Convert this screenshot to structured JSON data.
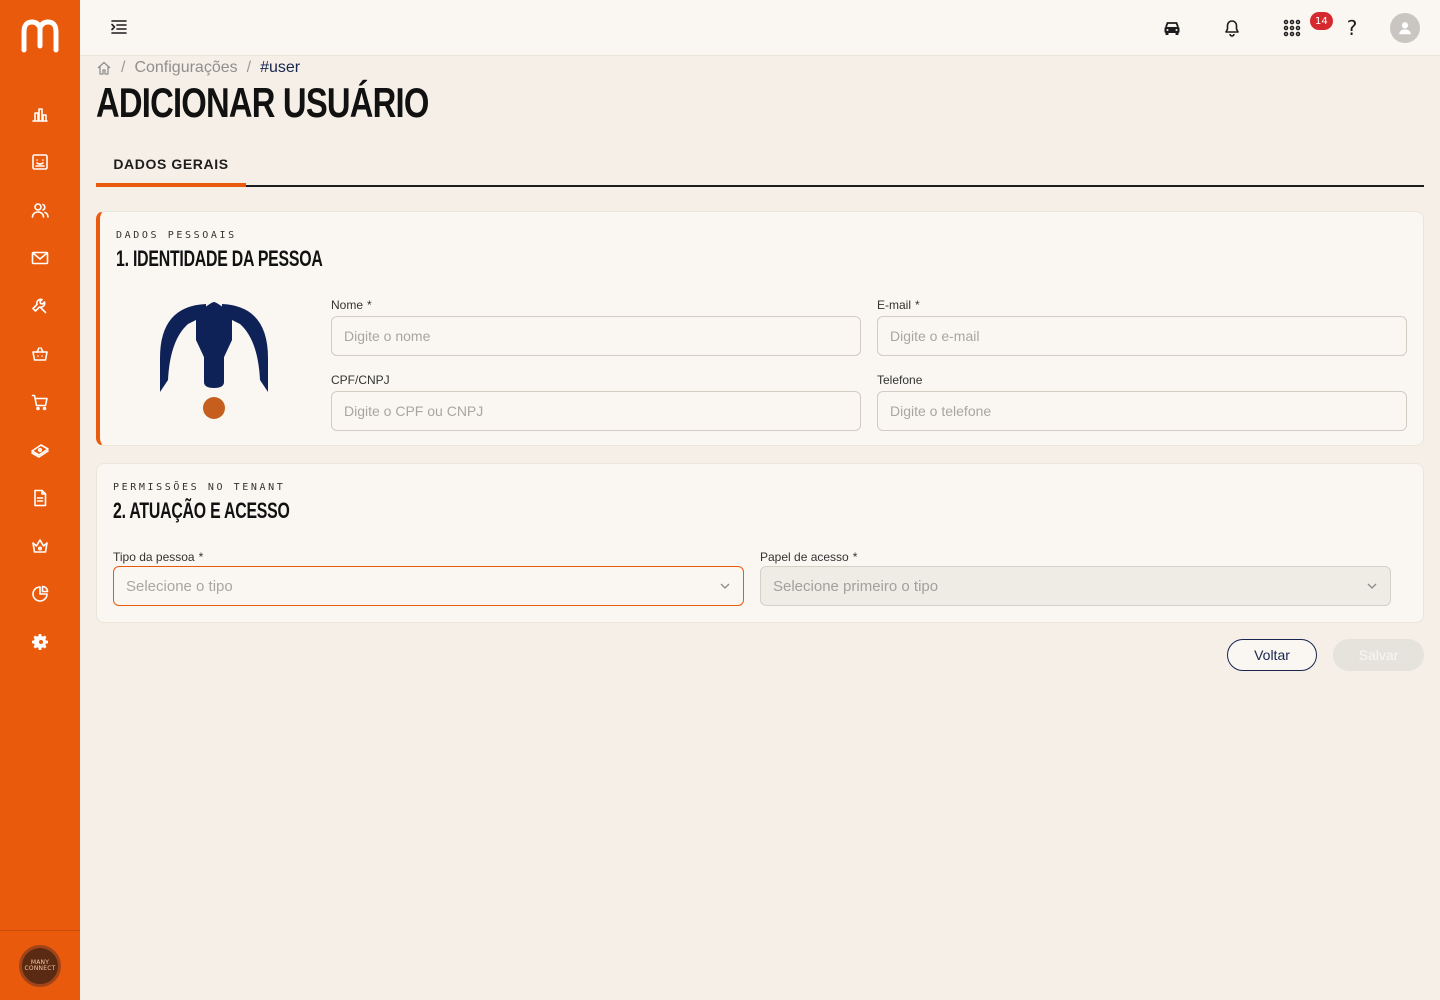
{
  "sidebar": {
    "items": [
      {
        "icon": "bar-chart-icon"
      },
      {
        "icon": "dashboard-icon"
      },
      {
        "icon": "users-icon"
      },
      {
        "icon": "mail-icon"
      },
      {
        "icon": "wrench-icon"
      },
      {
        "icon": "basket-icon"
      },
      {
        "icon": "cart-icon"
      },
      {
        "icon": "money-icon"
      },
      {
        "icon": "document-icon"
      },
      {
        "icon": "crown-icon"
      },
      {
        "icon": "pie-chart-icon"
      },
      {
        "icon": "gear-icon"
      }
    ],
    "brand_line1": "MANY",
    "brand_line2": "CONNECT"
  },
  "topbar": {
    "notifications_count": "14",
    "help": "?"
  },
  "breadcrumb": {
    "section": "Configurações",
    "current": "#user"
  },
  "page": {
    "title": "ADICIONAR USUÁRIO"
  },
  "tabs": [
    {
      "label": "DADOS GERAIS",
      "active": true
    }
  ],
  "identity": {
    "eyebrow": "DADOS PESSOAIS",
    "title": "1. IDENTIDADE DA PESSOA",
    "fields": {
      "name": {
        "label": "Nome",
        "required": "*",
        "placeholder": "Digite o nome",
        "value": ""
      },
      "email": {
        "label": "E-mail",
        "required": "*",
        "placeholder": "Digite o e-mail",
        "value": ""
      },
      "document": {
        "label": "CPF/CNPJ",
        "placeholder": "Digite o CPF ou CNPJ",
        "value": ""
      },
      "phone": {
        "label": "Telefone",
        "placeholder": "Digite o telefone",
        "value": ""
      }
    }
  },
  "access": {
    "eyebrow": "PERMISSÕES NO TENANT",
    "title": "2. ATUAÇÃO E ACESSO",
    "fields": {
      "person_type": {
        "label": "Tipo da pessoa",
        "required": "*",
        "placeholder": "Selecione o tipo"
      },
      "access_role": {
        "label": "Papel de acesso",
        "required": "*",
        "placeholder": "Selecione primeiro o tipo"
      }
    }
  },
  "actions": {
    "back": "Voltar",
    "save": "Salvar"
  },
  "colors": {
    "brand": "#ea5a0c",
    "navy": "#17254f",
    "background": "#f5efe7",
    "badge": "#d6292f"
  }
}
